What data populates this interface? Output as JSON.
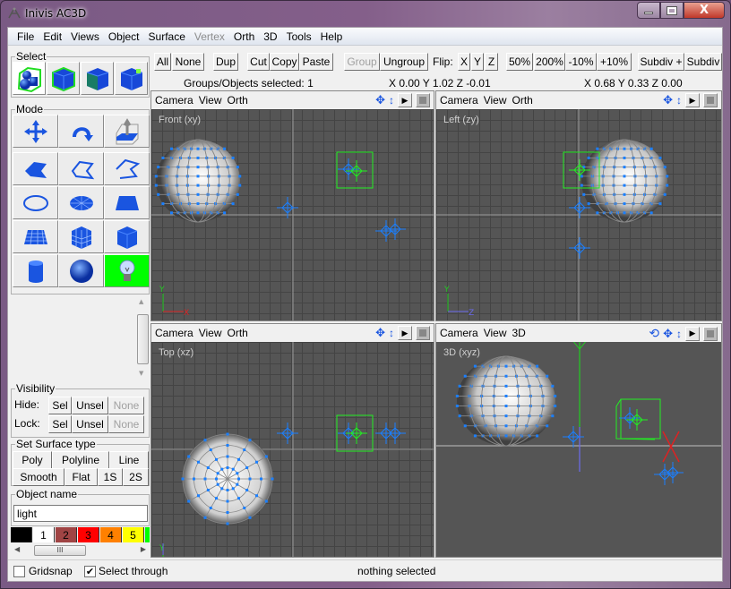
{
  "window": {
    "title": "Inivis AC3D",
    "minimize_label": "–",
    "maximize_label": "□",
    "close_label": "X"
  },
  "menubar": {
    "items": [
      {
        "label": "File",
        "enabled": true
      },
      {
        "label": "Edit",
        "enabled": true
      },
      {
        "label": "Views",
        "enabled": true
      },
      {
        "label": "Object",
        "enabled": true
      },
      {
        "label": "Surface",
        "enabled": true
      },
      {
        "label": "Vertex",
        "enabled": false
      },
      {
        "label": "Orth",
        "enabled": true
      },
      {
        "label": "3D",
        "enabled": true
      },
      {
        "label": "Tools",
        "enabled": true
      },
      {
        "label": "Help",
        "enabled": true
      }
    ]
  },
  "select_panel": {
    "title": "Select",
    "tools": [
      {
        "icon": "select-group-icon",
        "active": true
      },
      {
        "icon": "select-object-icon",
        "active": false
      },
      {
        "icon": "select-surface-icon",
        "active": false
      },
      {
        "icon": "select-vertex-icon",
        "active": false
      }
    ]
  },
  "mode_panel": {
    "title": "Mode",
    "tools": [
      {
        "icon": "move-icon",
        "active": false
      },
      {
        "icon": "rotate-icon",
        "active": false
      },
      {
        "icon": "extrude-icon",
        "active": false
      },
      {
        "icon": "polygon-icon",
        "active": false
      },
      {
        "icon": "polyline-icon",
        "active": false
      },
      {
        "icon": "line-icon",
        "active": false
      },
      {
        "icon": "circle-icon",
        "active": false
      },
      {
        "icon": "disc-icon",
        "active": false
      },
      {
        "icon": "rectangle-icon",
        "active": false
      },
      {
        "icon": "mesh-icon",
        "active": false
      },
      {
        "icon": "box-mesh-icon",
        "active": false
      },
      {
        "icon": "box-icon",
        "active": false
      },
      {
        "icon": "cylinder-icon",
        "active": false
      },
      {
        "icon": "sphere-icon",
        "active": false
      },
      {
        "icon": "light-icon",
        "active": true
      }
    ]
  },
  "visibility_panel": {
    "title": "Visibility",
    "hide_label": "Hide:",
    "lock_label": "Lock:",
    "sel_label": "Sel",
    "unsel_label": "Unsel",
    "none_label": "None"
  },
  "surface_panel": {
    "title": "Set Surface type",
    "row1": [
      "Poly",
      "Polyline",
      "Line"
    ],
    "row2": [
      "Smooth",
      "Flat",
      "1S",
      "2S"
    ]
  },
  "object_name_panel": {
    "title": "Object name",
    "value": "light"
  },
  "palette": {
    "swatches": [
      {
        "label": "",
        "color": "#000000"
      },
      {
        "label": "1",
        "color": "#ffffff"
      },
      {
        "label": "2",
        "color": "#a04444"
      },
      {
        "label": "3",
        "color": "#ff0000"
      },
      {
        "label": "4",
        "color": "#ff8000"
      },
      {
        "label": "5",
        "color": "#ffff00"
      },
      {
        "label": "",
        "color": "#00ff00"
      }
    ],
    "scroll_thumb_label": "III"
  },
  "toolbar": {
    "buttons": [
      {
        "label": "All",
        "enabled": true
      },
      {
        "label": "None",
        "enabled": true
      },
      {
        "label": "Dup",
        "enabled": true
      },
      {
        "label": "Cut",
        "enabled": true
      },
      {
        "label": "Copy",
        "enabled": true
      },
      {
        "label": "Paste",
        "enabled": true
      },
      {
        "label": "Group",
        "enabled": false
      },
      {
        "label": "Ungroup",
        "enabled": true
      }
    ],
    "flip_label": "Flip:",
    "flip_buttons": [
      "X",
      "Y",
      "Z"
    ],
    "scale_buttons": [
      "50%",
      "200%",
      "-10%",
      "+10%"
    ],
    "subdiv_plus_label": "Subdiv +",
    "subdiv_label": "Subdiv"
  },
  "info": {
    "selected_count": "Groups/Objects selected: 1",
    "cursor_coords": "X 0.00 Y 1.02 Z -0.01",
    "selection_coords": "X 0.68 Y 0.33 Z 0.00"
  },
  "viewports": [
    {
      "menu": [
        "Camera",
        "View",
        "Orth"
      ],
      "name": "Front (xy)",
      "mode": "orth"
    },
    {
      "menu": [
        "Camera",
        "View",
        "Orth"
      ],
      "name": "Left (zy)",
      "mode": "orth"
    },
    {
      "menu": [
        "Camera",
        "View",
        "Orth"
      ],
      "name": "Top (xz)",
      "mode": "orth"
    },
    {
      "menu": [
        "Camera",
        "View",
        "3D"
      ],
      "name": "3D (xyz)",
      "mode": "3d"
    }
  ],
  "statusbar": {
    "gridsnap_label": "Gridsnap",
    "gridsnap_checked": false,
    "select_through_label": "Select through",
    "select_through_checked": true,
    "status_text": "nothing selected"
  },
  "colors": {
    "accent_selection": "#00ff00",
    "vertex_blue": "#1a7fff",
    "viewport_bg": "#555555"
  }
}
